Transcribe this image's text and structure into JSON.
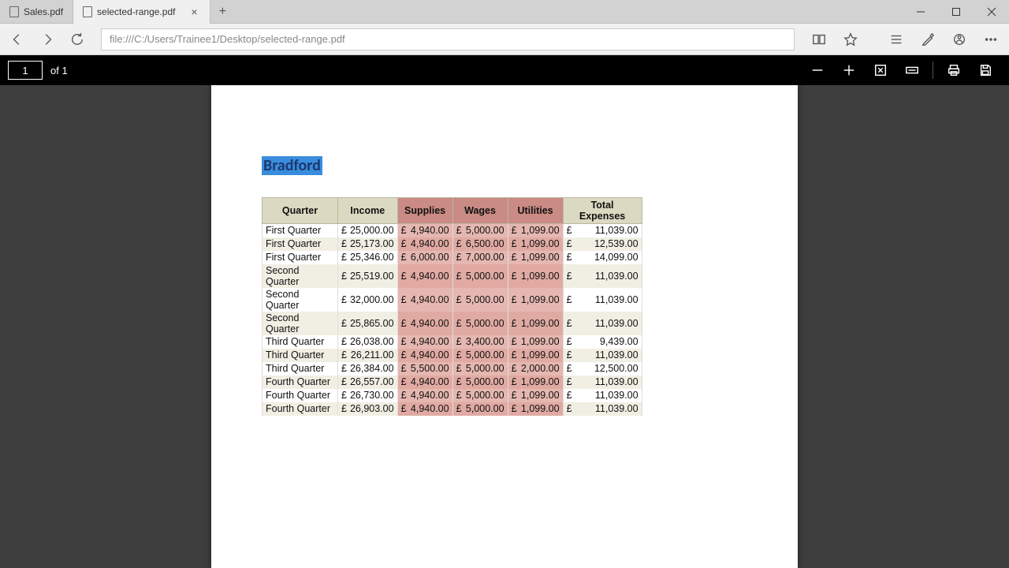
{
  "tabs": [
    {
      "label": "Sales.pdf",
      "active": false
    },
    {
      "label": "selected-range.pdf",
      "active": true
    }
  ],
  "address": "file:///C:/Users/Trainee1/Desktop/selected-range.pdf",
  "pdf": {
    "current_page": "1",
    "page_label": "of 1"
  },
  "document": {
    "title": "Bradford",
    "headers": [
      "Quarter",
      "Income",
      "Supplies",
      "Wages",
      "Utilities",
      "Total Expenses"
    ],
    "currency": "£",
    "rows": [
      {
        "quarter": "First Quarter",
        "income": "25,000.00",
        "supplies": "4,940.00",
        "wages": "5,000.00",
        "utilities": "1,099.00",
        "total": "11,039.00"
      },
      {
        "quarter": "First Quarter",
        "income": "25,173.00",
        "supplies": "4,940.00",
        "wages": "6,500.00",
        "utilities": "1,099.00",
        "total": "12,539.00"
      },
      {
        "quarter": "First Quarter",
        "income": "25,346.00",
        "supplies": "6,000.00",
        "wages": "7,000.00",
        "utilities": "1,099.00",
        "total": "14,099.00"
      },
      {
        "quarter": "Second Quarter",
        "income": "25,519.00",
        "supplies": "4,940.00",
        "wages": "5,000.00",
        "utilities": "1,099.00",
        "total": "11,039.00"
      },
      {
        "quarter": "Second Quarter",
        "income": "32,000.00",
        "supplies": "4,940.00",
        "wages": "5,000.00",
        "utilities": "1,099.00",
        "total": "11,039.00"
      },
      {
        "quarter": "Second Quarter",
        "income": "25,865.00",
        "supplies": "4,940.00",
        "wages": "5,000.00",
        "utilities": "1,099.00",
        "total": "11,039.00"
      },
      {
        "quarter": "Third Quarter",
        "income": "26,038.00",
        "supplies": "4,940.00",
        "wages": "3,400.00",
        "utilities": "1,099.00",
        "total": "9,439.00"
      },
      {
        "quarter": "Third Quarter",
        "income": "26,211.00",
        "supplies": "4,940.00",
        "wages": "5,000.00",
        "utilities": "1,099.00",
        "total": "11,039.00"
      },
      {
        "quarter": "Third Quarter",
        "income": "26,384.00",
        "supplies": "5,500.00",
        "wages": "5,000.00",
        "utilities": "2,000.00",
        "total": "12,500.00"
      },
      {
        "quarter": "Fourth Quarter",
        "income": "26,557.00",
        "supplies": "4,940.00",
        "wages": "5,000.00",
        "utilities": "1,099.00",
        "total": "11,039.00"
      },
      {
        "quarter": "Fourth Quarter",
        "income": "26,730.00",
        "supplies": "4,940.00",
        "wages": "5,000.00",
        "utilities": "1,099.00",
        "total": "11,039.00"
      },
      {
        "quarter": "Fourth Quarter",
        "income": "26,903.00",
        "supplies": "4,940.00",
        "wages": "5,000.00",
        "utilities": "1,099.00",
        "total": "11,039.00"
      }
    ]
  }
}
